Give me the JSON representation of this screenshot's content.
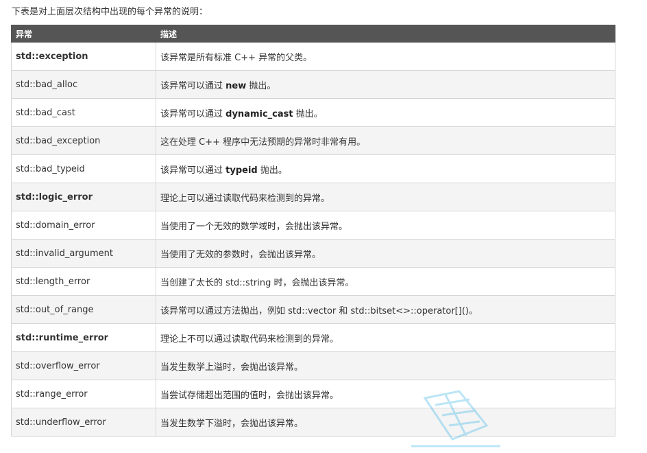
{
  "intro_text": "下表是对上面层次结构中出现的每个异常的说明：",
  "table": {
    "headers": [
      "异常",
      "描述"
    ],
    "rows": [
      {
        "name": "std::exception",
        "bold": true,
        "desc_pre": "该异常是所有标准 C++ 异常的父类。",
        "desc_kw": "",
        "desc_post": ""
      },
      {
        "name": "std::bad_alloc",
        "bold": false,
        "desc_pre": "该异常可以通过 ",
        "desc_kw": "new",
        "desc_post": " 抛出。"
      },
      {
        "name": "std::bad_cast",
        "bold": false,
        "desc_pre": "该异常可以通过 ",
        "desc_kw": "dynamic_cast",
        "desc_post": " 抛出。"
      },
      {
        "name": "std::bad_exception",
        "bold": false,
        "desc_pre": "这在处理 C++ 程序中无法预期的异常时非常有用。",
        "desc_kw": "",
        "desc_post": ""
      },
      {
        "name": "std::bad_typeid",
        "bold": false,
        "desc_pre": "该异常可以通过 ",
        "desc_kw": "typeid",
        "desc_post": " 抛出。"
      },
      {
        "name": "std::logic_error",
        "bold": true,
        "desc_pre": "理论上可以通过读取代码来检测到的异常。",
        "desc_kw": "",
        "desc_post": ""
      },
      {
        "name": "std::domain_error",
        "bold": false,
        "desc_pre": "当使用了一个无效的数学域时，会抛出该异常。",
        "desc_kw": "",
        "desc_post": ""
      },
      {
        "name": "std::invalid_argument",
        "bold": false,
        "desc_pre": "当使用了无效的参数时，会抛出该异常。",
        "desc_kw": "",
        "desc_post": ""
      },
      {
        "name": "std::length_error",
        "bold": false,
        "desc_pre": "当创建了太长的 std::string 时，会抛出该异常。",
        "desc_kw": "",
        "desc_post": ""
      },
      {
        "name": "std::out_of_range",
        "bold": false,
        "desc_pre": "该异常可以通过方法抛出，例如 std::vector 和 std::bitset<>::operator[]()。",
        "desc_kw": "",
        "desc_post": ""
      },
      {
        "name": "std::runtime_error",
        "bold": true,
        "desc_pre": "理论上不可以通过读取代码来检测到的异常。",
        "desc_kw": "",
        "desc_post": ""
      },
      {
        "name": "std::overflow_error",
        "bold": false,
        "desc_pre": "当发生数学上溢时，会抛出该异常。",
        "desc_kw": "",
        "desc_post": ""
      },
      {
        "name": "std::range_error",
        "bold": false,
        "desc_pre": "当尝试存储超出范围的值时，会抛出该异常。",
        "desc_kw": "",
        "desc_post": ""
      },
      {
        "name": "std::underflow_error",
        "bold": false,
        "desc_pre": "当发生数学下溢时，会抛出该异常。",
        "desc_kw": "",
        "desc_post": ""
      }
    ]
  },
  "watermark_color": "#3fb6e8"
}
